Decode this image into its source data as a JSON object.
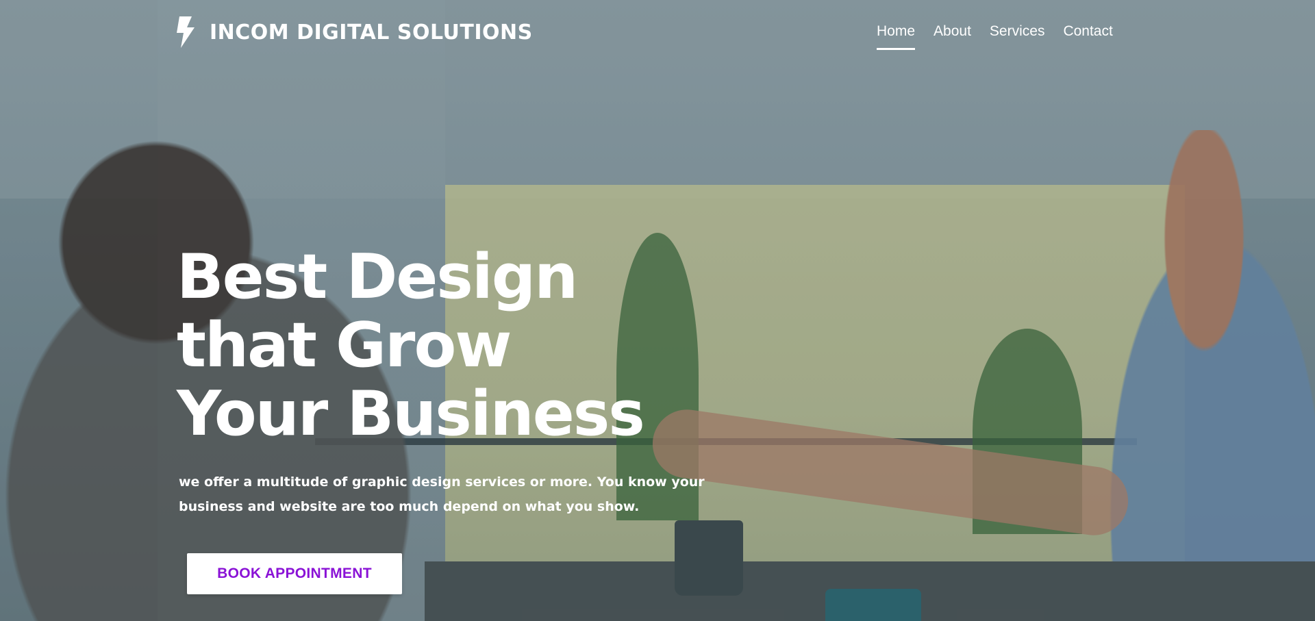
{
  "brand": {
    "name": "INCOM DIGITAL SOLUTIONS",
    "icon": "lightning-bolt-icon"
  },
  "nav": {
    "items": [
      {
        "label": "Home",
        "active": true
      },
      {
        "label": "About",
        "active": false
      },
      {
        "label": "Services",
        "active": false
      },
      {
        "label": "Contact",
        "active": false
      }
    ]
  },
  "hero": {
    "title_lines": [
      "Best Design",
      "that Grow",
      "Your Business"
    ],
    "subtitle_lines": [
      "we offer a multitude of graphic design services or more. You know your",
      "business and website are too much depend on what you show."
    ],
    "cta_label": "BOOK APPOINTMENT"
  },
  "colors": {
    "text": "#ffffff",
    "cta_text": "#8a12d6",
    "cta_background": "#ffffff"
  }
}
